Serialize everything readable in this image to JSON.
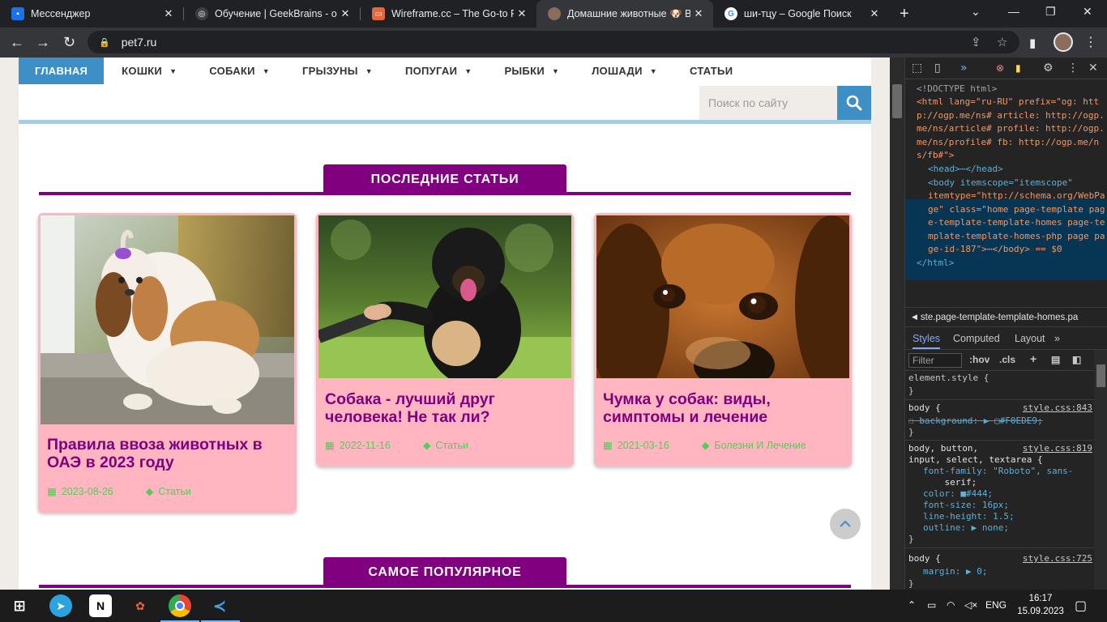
{
  "browser": {
    "tabs": [
      {
        "title": "Мессенджер",
        "color": "#1a73e8"
      },
      {
        "title": "Обучение | GeekBrains - об",
        "color": "#3c4043"
      },
      {
        "title": "Wireframe.cc – The Go-to Fr",
        "color": "#e8663c"
      },
      {
        "title": "Домашние животные 🐶 В",
        "color": "#8a6d5c"
      },
      {
        "title": "ши-тцу – Google Поиск",
        "color": "#ffffff"
      }
    ],
    "url": "pet7.ru"
  },
  "site": {
    "nav": [
      {
        "label": "ГЛАВНАЯ"
      },
      {
        "label": "КОШКИ"
      },
      {
        "label": "СОБАКИ"
      },
      {
        "label": "ГРЫЗУНЫ"
      },
      {
        "label": "ПОПУГАИ"
      },
      {
        "label": "РЫБКИ"
      },
      {
        "label": "ЛОШАДИ"
      },
      {
        "label": "СТАТЬИ"
      }
    ],
    "search_placeholder": "Поиск по сайту",
    "section_latest": "ПОСЛЕДНИЕ СТАТЬИ",
    "section_popular": "САМОЕ ПОПУЛЯРНОЕ",
    "cards": [
      {
        "title": "Правила ввоза животных в ОАЭ в 2023 году",
        "date": "2023-08-26",
        "category": "Статьи"
      },
      {
        "title": "Собака - лучший друг человека! Не так ли?",
        "date": "2022-11-16",
        "category": "Статьи"
      },
      {
        "title": "Чумка у собак: виды, симптомы и лечение",
        "date": "2021-03-16",
        "category": "Болезни И Лечение"
      }
    ]
  },
  "devtools": {
    "dom": {
      "doctype": "<!DOCTYPE html>",
      "html_open_1": "<html lang=\"ru-RU\" prefix=\"og: htt",
      "html_open_2": "p://ogp.me/ns# article: http://ogp.",
      "html_open_3": "me/ns/article# profile: http://ogp.",
      "html_open_4": "me/ns/profile# fb: http://ogp.me/n",
      "html_open_5": "s/fb#\">",
      "head": "<head>⋯</head>",
      "body_1": "<body itemscope=\"itemscope\"",
      "body_2": "itemtype=\"http://schema.org/WebPa",
      "body_3": "ge\" class=\"home page-template pag",
      "body_4": "e-template-template-homes page-te",
      "body_5": "mplate-template-homes-php page pa",
      "body_6": "ge-id-187\">⋯</body> == $0",
      "html_close": "</html>"
    },
    "breadcrumb": "ste.page-template-template-homes.pa",
    "tabs": [
      "Styles",
      "Computed",
      "Layout"
    ],
    "filter_placeholder": "Filter",
    "hov": ":hov",
    "cls": ".cls",
    "rules": {
      "element_style": "element.style {",
      "close": "}",
      "r1_sel": "body {",
      "r1_src": "style.css:843",
      "r1_prop": "background: ▶ ▢#F0EDE9;",
      "r2_sel": "body, button,",
      "r2_sel2": "input, select, textarea {",
      "r2_src": "style.css:819",
      "r2_p1": "font-family: \"Roboto\", sans-",
      "r2_p1b": "    serif;",
      "r2_p2": "color: ■#444;",
      "r2_p3": "font-size: 16px;",
      "r2_p4": "line-height: 1.5;",
      "r2_p5": "outline: ▶ none;",
      "r3_sel": "body {",
      "r3_src": "style.css:725",
      "r3_p1": "margin: ▶ 0;"
    }
  },
  "taskbar": {
    "lang": "ENG",
    "time": "16:17",
    "date": "15.09.2023"
  }
}
